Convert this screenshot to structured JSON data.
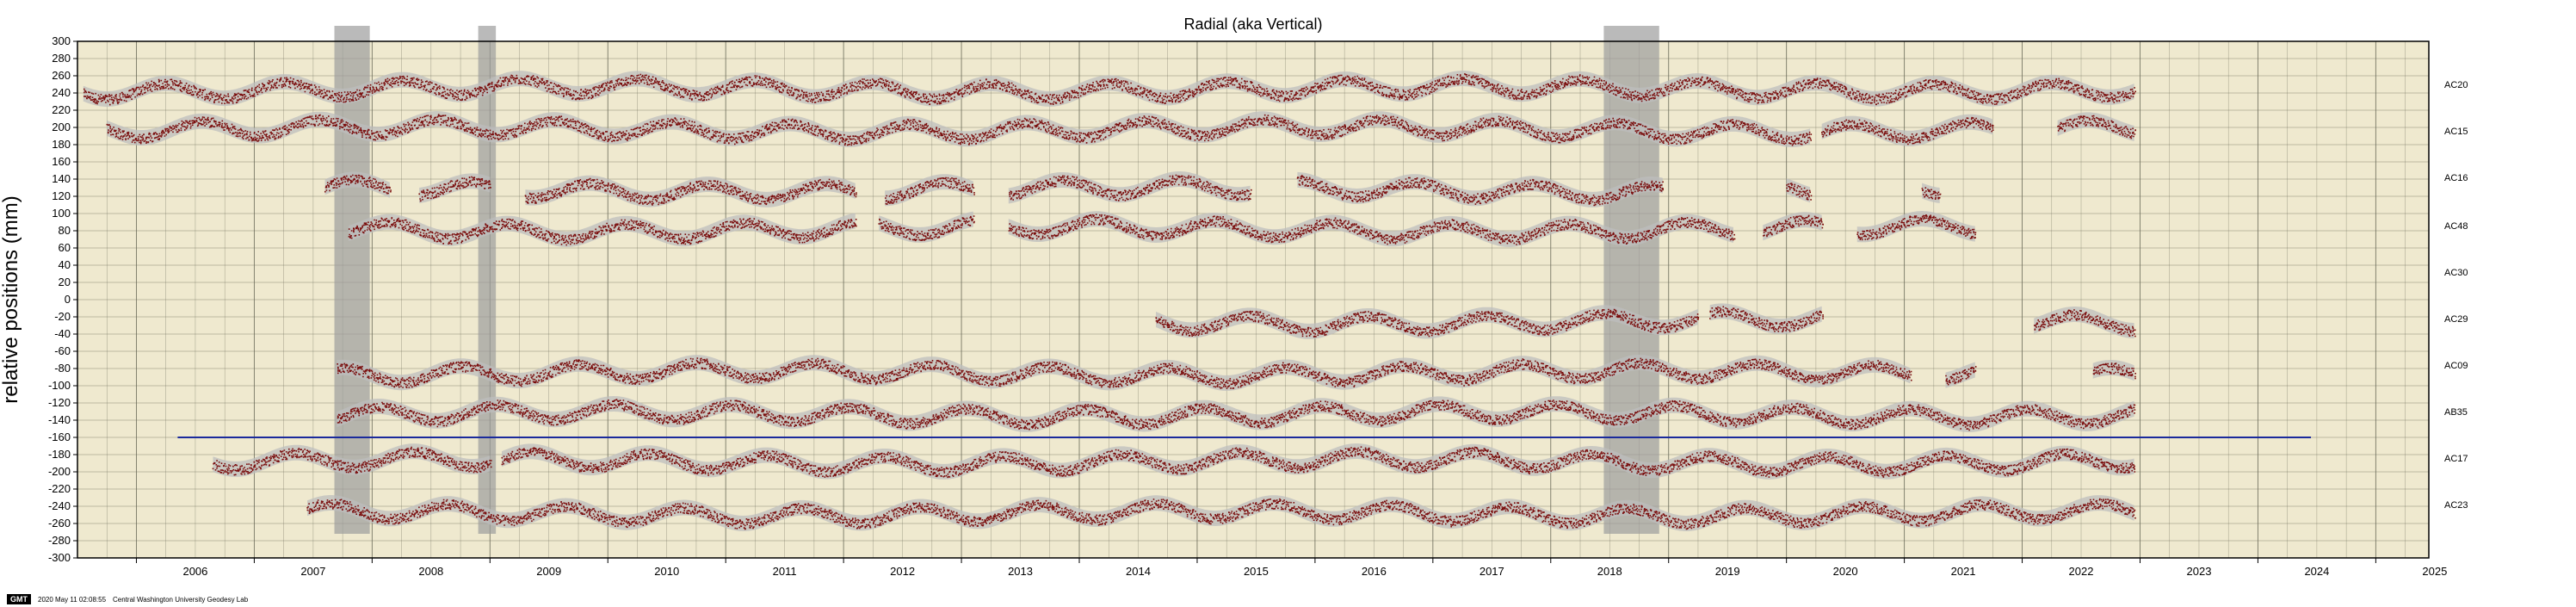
{
  "chart_data": {
    "type": "scatter",
    "title": "Radial (aka Vertical)",
    "ylabel": "relative positions (mm)",
    "xlabel": "",
    "xlim": [
      2005.5,
      2025.45
    ],
    "ylim": [
      -300,
      300
    ],
    "y_tick_step": 20,
    "x_tick_labels": [
      "2006",
      "2007",
      "2008",
      "2009",
      "2010",
      "2011",
      "2012",
      "2013",
      "2014",
      "2015",
      "2016",
      "2017",
      "2018",
      "2019",
      "2020",
      "2021",
      "2022",
      "2023",
      "2024",
      "2025"
    ],
    "grid": true,
    "colors": {
      "background": "#efe9cf",
      "points": "#7a0c0c",
      "error_band": "#bdbdbd",
      "outage_band": "#9d9d9d",
      "reference_line": "#1a2a9c",
      "grid": "#6b6b5a"
    },
    "reference_line_y": -160,
    "reference_line_x": [
      2006.35,
      2024.45
    ],
    "outage_bands": [
      {
        "x": [
          2007.68,
          2007.98
        ],
        "y": [
          -272,
          318
        ]
      },
      {
        "x": [
          2008.9,
          2009.05
        ],
        "y": [
          -272,
          318
        ]
      },
      {
        "x": [
          2018.45,
          2018.92
        ],
        "y": [
          -272,
          318
        ]
      }
    ],
    "series": [
      {
        "name": "AC20",
        "offset": 245,
        "segments": [
          [
            2005.55,
            2022.95
          ]
        ]
      },
      {
        "name": "AC15",
        "offset": 198,
        "segments": [
          [
            2005.75,
            2020.2
          ],
          [
            2020.3,
            2021.75
          ],
          [
            2022.3,
            2022.95
          ]
        ]
      },
      {
        "name": "AC16",
        "offset": 128,
        "segments": [
          [
            2007.6,
            2008.15
          ],
          [
            2008.4,
            2009.0
          ],
          [
            2009.3,
            2012.1
          ],
          [
            2012.35,
            2013.1
          ],
          [
            2013.4,
            2015.45
          ],
          [
            2015.85,
            2018.95
          ],
          [
            2020.0,
            2020.2
          ],
          [
            2021.15,
            2021.3
          ]
        ]
      },
      {
        "name": "AC48",
        "offset": 82,
        "segments": [
          [
            2007.8,
            2012.1
          ],
          [
            2012.3,
            2013.1
          ],
          [
            2013.4,
            2019.55
          ],
          [
            2019.8,
            2020.3
          ],
          [
            2020.6,
            2021.6
          ]
        ]
      },
      {
        "name": "AC29",
        "offset": -25,
        "segments": [
          [
            2014.65,
            2019.25
          ],
          [
            2019.35,
            2020.3
          ],
          [
            2022.1,
            2022.95
          ]
        ]
      },
      {
        "name": "AC09",
        "offset": -85,
        "segments": [
          [
            2007.7,
            2021.05
          ],
          [
            2021.35,
            2021.6
          ],
          [
            2022.6,
            2022.95
          ]
        ]
      },
      {
        "name": "AB35",
        "offset": -133,
        "segments": [
          [
            2007.7,
            2022.95
          ]
        ]
      },
      {
        "name": "AC17",
        "offset": -188,
        "segments": [
          [
            2006.65,
            2009.0
          ],
          [
            2009.1,
            2022.95
          ]
        ]
      },
      {
        "name": "AC23",
        "offset": -248,
        "segments": [
          [
            2007.45,
            2022.95
          ]
        ]
      }
    ],
    "station_labels": [
      {
        "name": "AC20",
        "y": 250
      },
      {
        "name": "AC15",
        "y": 196
      },
      {
        "name": "AC16",
        "y": 142
      },
      {
        "name": "AC48",
        "y": 86
      },
      {
        "name": "AC30",
        "y": 32
      },
      {
        "name": "AC29",
        "y": -22
      },
      {
        "name": "AC09",
        "y": -76
      },
      {
        "name": "AB35",
        "y": -130
      },
      {
        "name": "AC17",
        "y": -184
      },
      {
        "name": "AC23",
        "y": -238
      }
    ]
  },
  "footer": {
    "logo": "GMT",
    "timestamp": "2020 May 11 02:08:55",
    "credit": "Central Washington University Geodesy Lab"
  }
}
